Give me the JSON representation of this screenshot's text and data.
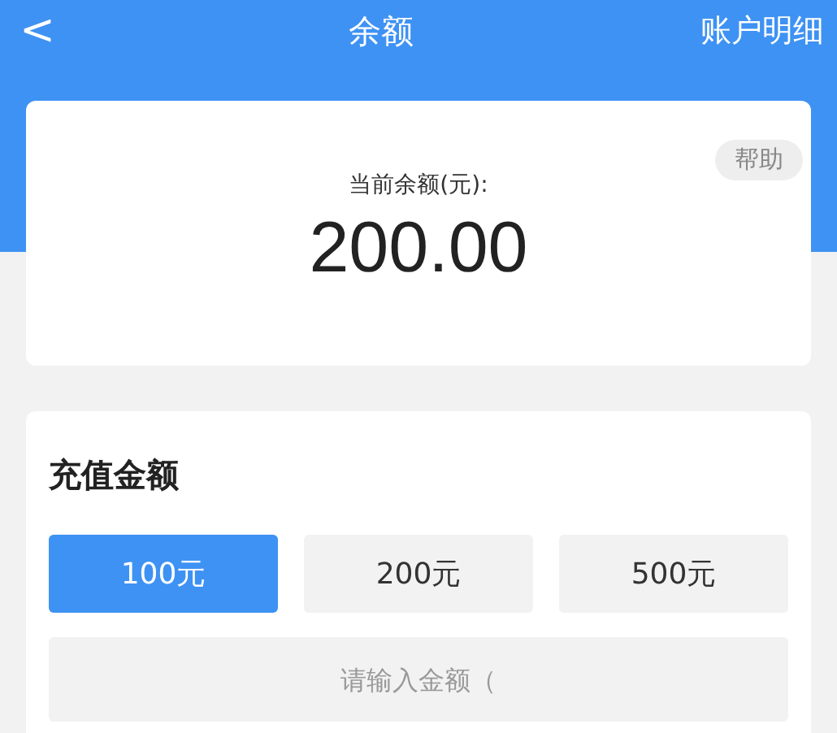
{
  "header": {
    "back": "<",
    "title": "余额",
    "action": "账户明细"
  },
  "balance": {
    "help": "帮助",
    "label": "当前余额(元):",
    "amount": "200.00"
  },
  "recharge": {
    "title": "充值金额",
    "options": [
      {
        "label": "100元",
        "selected": true
      },
      {
        "label": "200元",
        "selected": false
      },
      {
        "label": "500元",
        "selected": false
      }
    ],
    "input": {
      "placeholder": "请输入金额（"
    }
  }
}
